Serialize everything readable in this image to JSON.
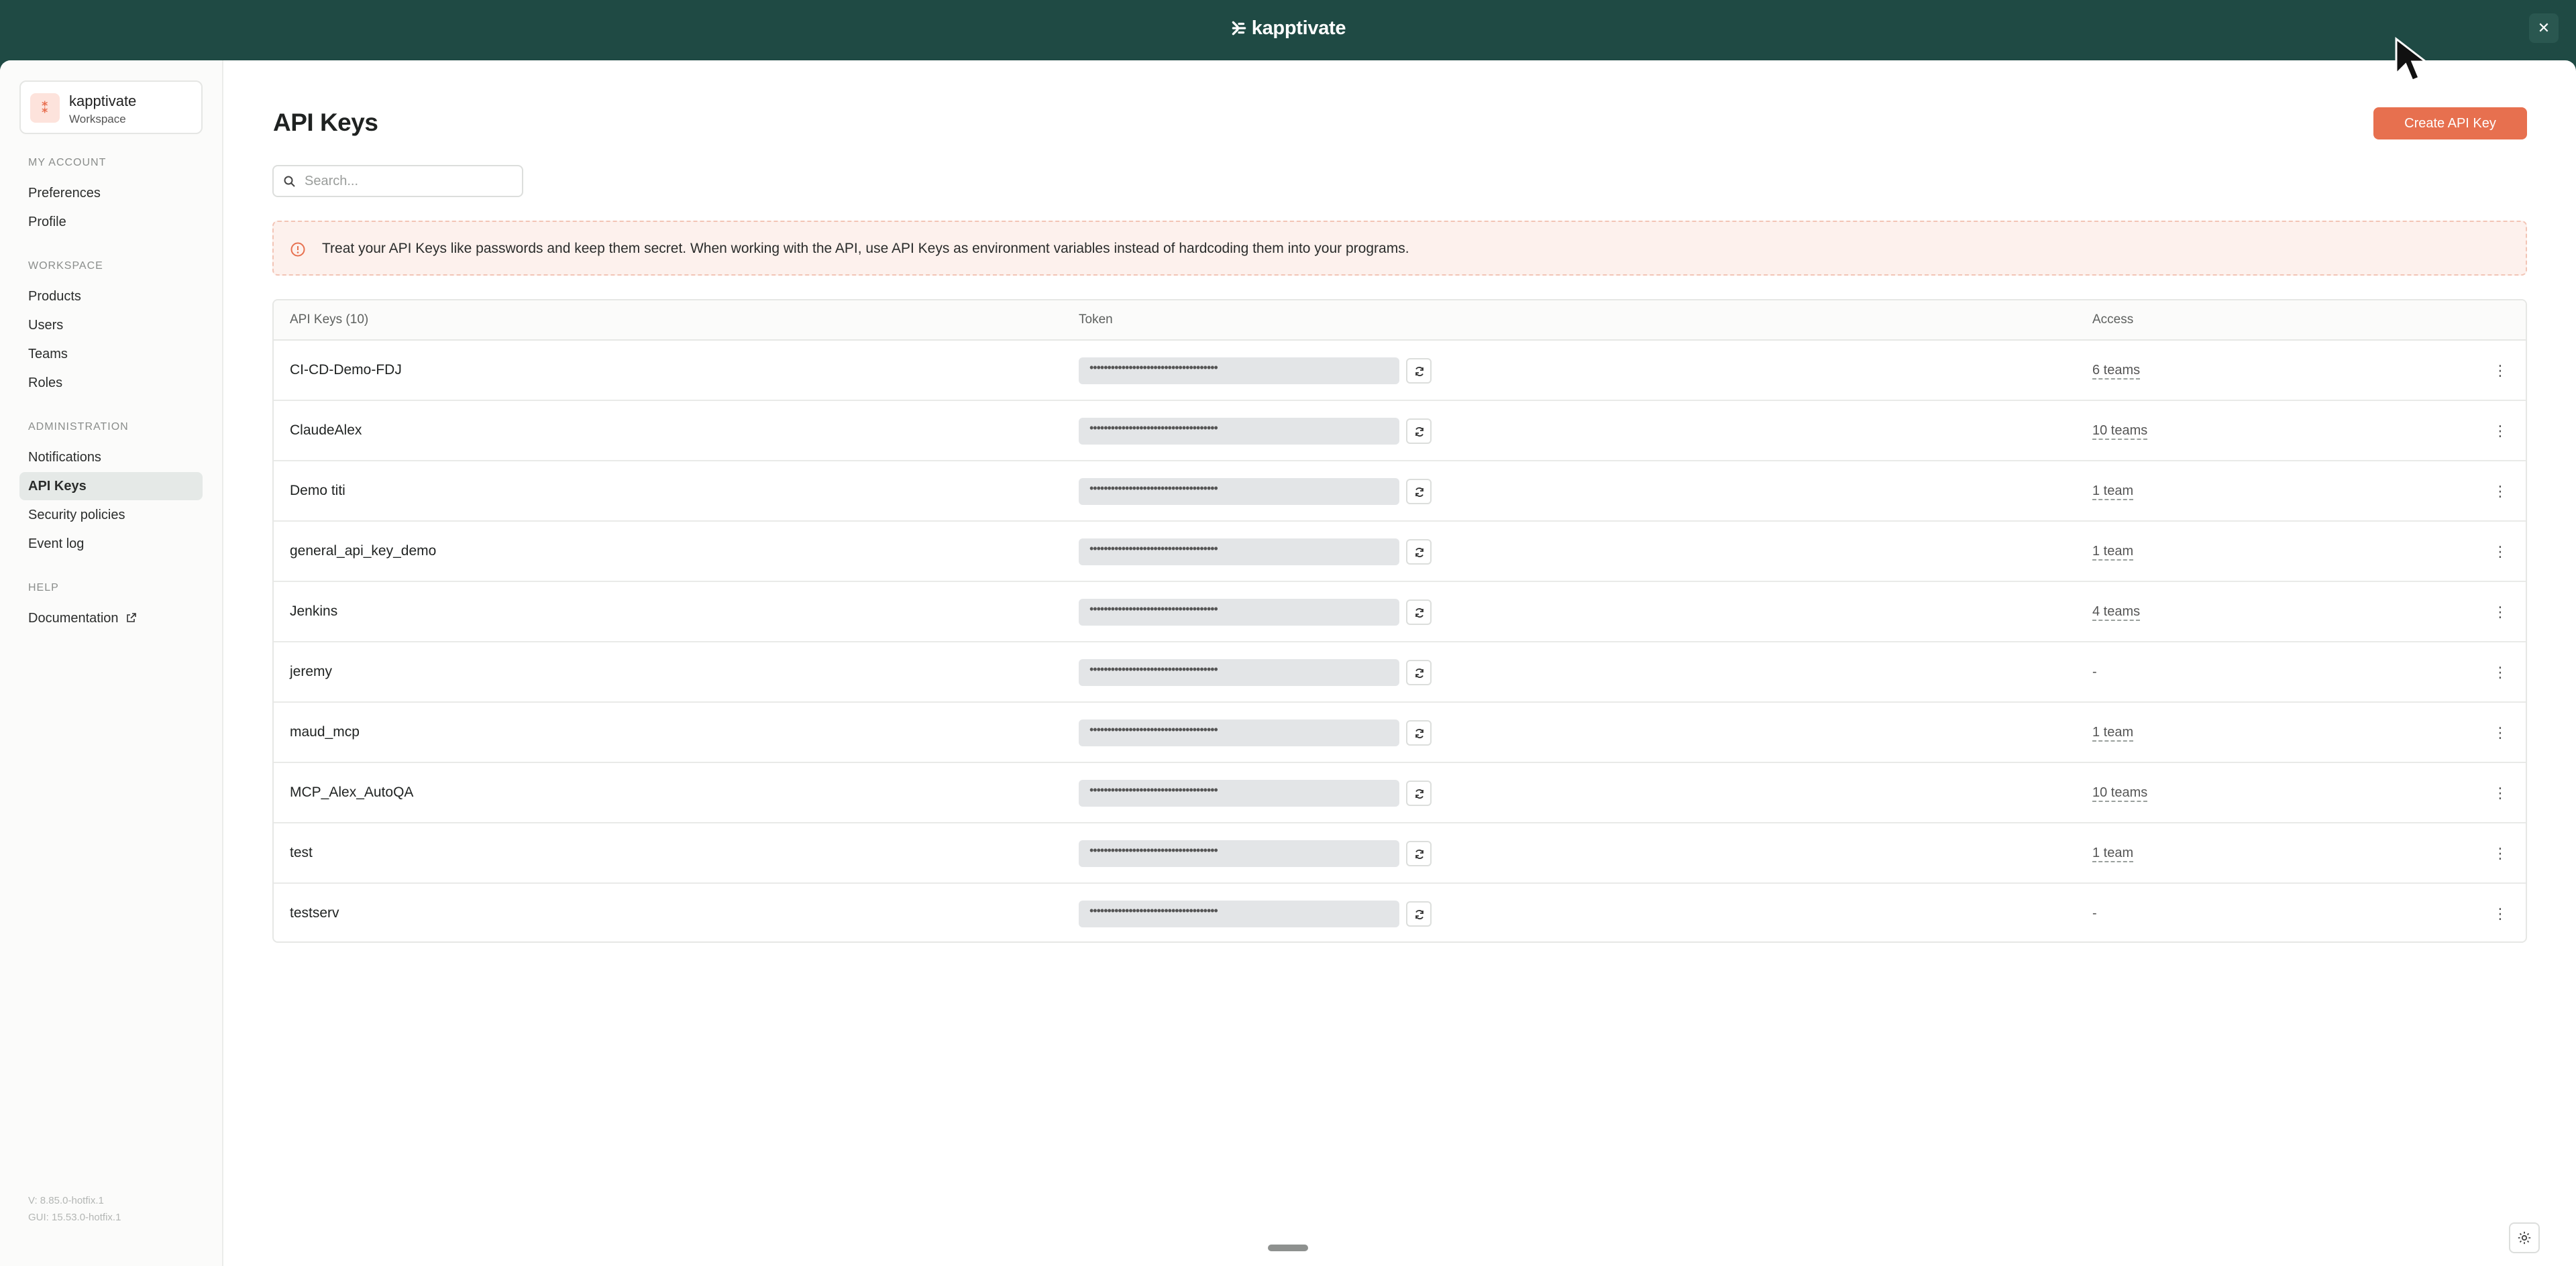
{
  "app": {
    "brand": "kapptivate"
  },
  "workspace": {
    "name": "kapptivate",
    "subtitle": "Workspace"
  },
  "sidebar": {
    "sections": [
      {
        "title": "MY ACCOUNT",
        "items": [
          {
            "label": "Preferences"
          },
          {
            "label": "Profile"
          }
        ]
      },
      {
        "title": "WORKSPACE",
        "items": [
          {
            "label": "Products"
          },
          {
            "label": "Users"
          },
          {
            "label": "Teams"
          },
          {
            "label": "Roles"
          }
        ]
      },
      {
        "title": "ADMINISTRATION",
        "items": [
          {
            "label": "Notifications"
          },
          {
            "label": "API Keys",
            "active": true
          },
          {
            "label": "Security policies"
          },
          {
            "label": "Event log"
          }
        ]
      },
      {
        "title": "HELP",
        "items": [
          {
            "label": "Documentation",
            "icon": "external-link-icon"
          }
        ]
      }
    ],
    "version": {
      "app": "V: 8.85.0-hotfix.1",
      "gui": "GUI: 15.53.0-hotfix.1"
    }
  },
  "page": {
    "title": "API Keys",
    "create_label": "Create API Key",
    "search": {
      "placeholder": "Search...",
      "value": ""
    },
    "alert": "Treat your API Keys like passwords and keep them secret. When working with the API, use API Keys as environment variables instead of hardcoding them into your programs."
  },
  "table": {
    "headers": {
      "name": "API Keys (10)",
      "token": "Token",
      "access": "Access"
    },
    "masked_token": "••••••••••••••••••••••••••••••••••••",
    "rows": [
      {
        "name": "CI-CD-Demo-FDJ",
        "access": "6 teams"
      },
      {
        "name": "ClaudeAlex",
        "access": "10 teams"
      },
      {
        "name": "Demo titi",
        "access": "1 team"
      },
      {
        "name": "general_api_key_demo",
        "access": "1 team"
      },
      {
        "name": "Jenkins",
        "access": "4 teams"
      },
      {
        "name": "jeremy",
        "access": "-"
      },
      {
        "name": "maud_mcp",
        "access": "1 team"
      },
      {
        "name": "MCP_Alex_AutoQA",
        "access": "10 teams"
      },
      {
        "name": "test",
        "access": "1 team"
      },
      {
        "name": "testserv",
        "access": "-"
      }
    ]
  },
  "colors": {
    "header_bg": "#1f4a44",
    "accent": "#e7704f",
    "alert_bg": "#fdf1ed"
  }
}
